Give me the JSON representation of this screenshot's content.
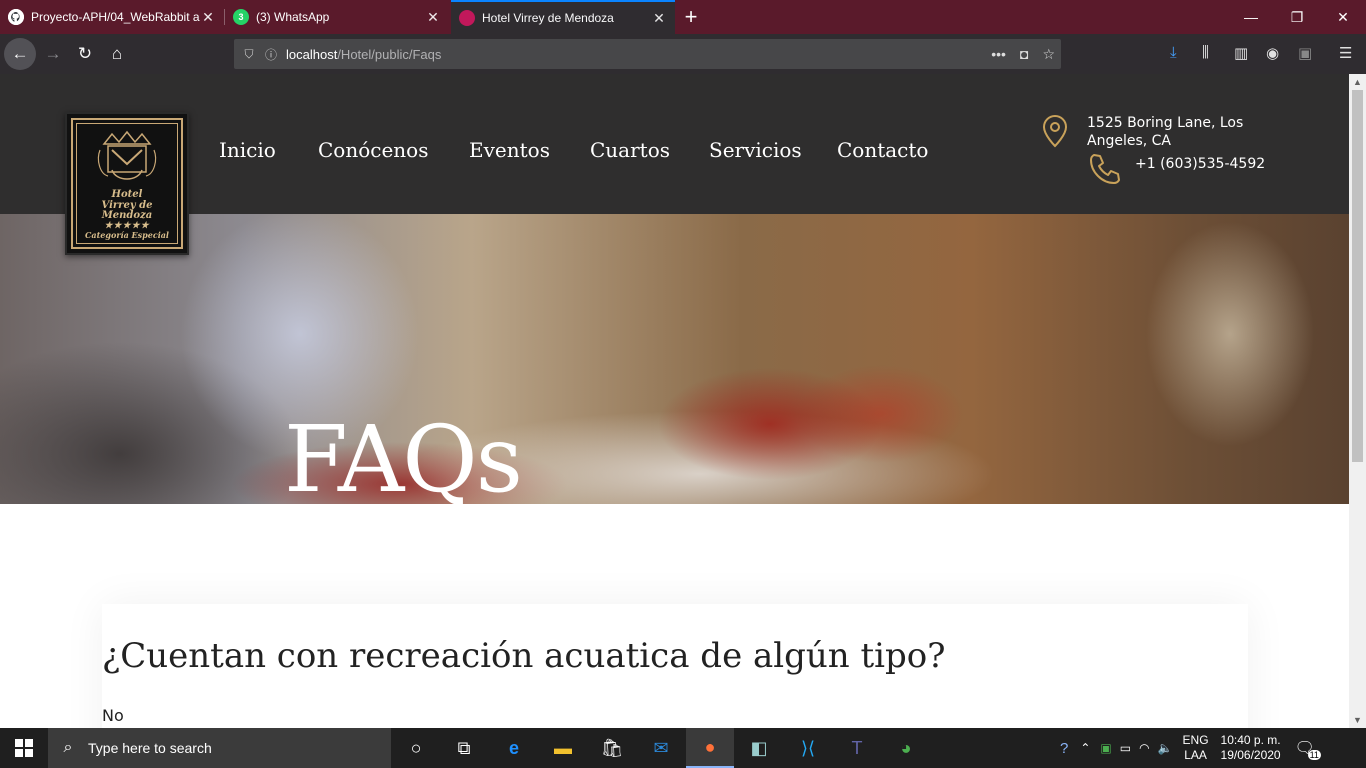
{
  "browser": {
    "tabs": [
      {
        "title": "Proyecto-APH/04_WebRabbit a",
        "icon": "github-icon",
        "active": false
      },
      {
        "title": "(3) WhatsApp",
        "icon": "whatsapp-icon",
        "badge": "3",
        "active": false
      },
      {
        "title": "Hotel Virrey de Mendoza",
        "icon": "hotel-favicon",
        "active": true
      }
    ],
    "url_host": "localhost",
    "url_path": "/Hotel/public/Faqs"
  },
  "site": {
    "logo": {
      "line1": "Hotel",
      "line2": "Virrey de Mendoza",
      "stars": "★★★★★",
      "line3": "Categoría Especial"
    },
    "menu": [
      "Inicio",
      "Conócenos",
      "Eventos",
      "Cuartos",
      "Servicios",
      "Contacto"
    ],
    "address_line1": "1525 Boring Lane, Los",
    "address_line2": "Angeles, CA",
    "phone": "+1 (603)535-4592",
    "accent_color": "#c9a25a",
    "hero_title": "FAQs"
  },
  "faq": {
    "question": "¿Cuentan con recreación acuatica de algún tipo?",
    "answer": "No"
  },
  "taskbar": {
    "search_placeholder": "Type here to search",
    "lang_top": "ENG",
    "lang_bottom": "LAA",
    "time": "10:40 p. m.",
    "date": "19/06/2020",
    "notification_count": "11"
  }
}
